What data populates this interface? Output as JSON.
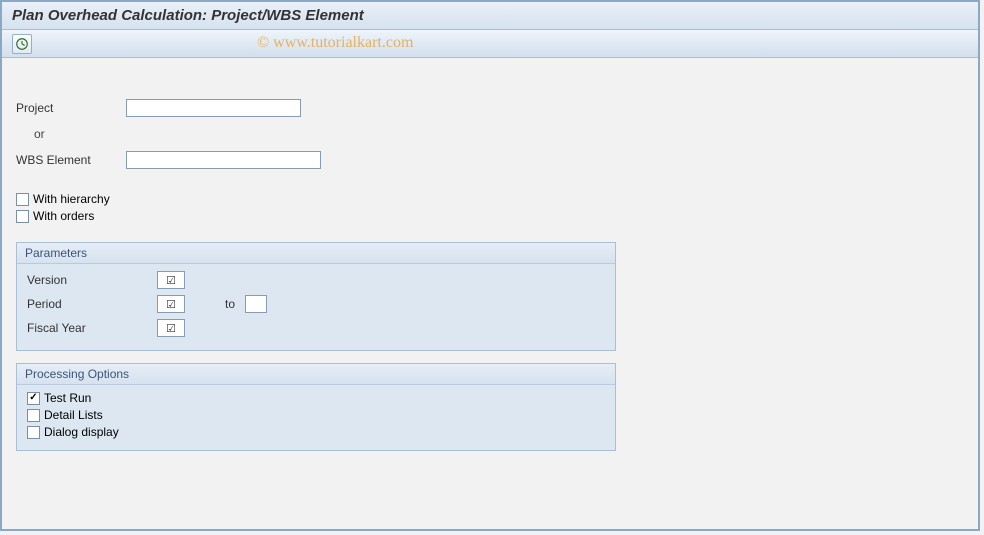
{
  "title": "Plan Overhead Calculation: Project/WBS Element",
  "watermark": "© www.tutorialkart.com",
  "selection": {
    "project_label": "Project",
    "project_value": "",
    "or_label": "or",
    "wbs_label": "WBS Element",
    "wbs_value": "",
    "with_hierarchy_label": "With hierarchy",
    "with_hierarchy_checked": false,
    "with_orders_label": "With orders",
    "with_orders_checked": false
  },
  "parameters": {
    "group_title": "Parameters",
    "version_label": "Version",
    "version_required": true,
    "version_value": "",
    "period_label": "Period",
    "period_required": true,
    "period_from": "",
    "to_label": "to",
    "period_to": "",
    "fiscal_year_label": "Fiscal Year",
    "fiscal_year_required": true,
    "fiscal_year_value": ""
  },
  "processing": {
    "group_title": "Processing Options",
    "test_run_label": "Test Run",
    "test_run_checked": true,
    "detail_lists_label": "Detail Lists",
    "detail_lists_checked": false,
    "dialog_display_label": "Dialog display",
    "dialog_display_checked": false
  }
}
